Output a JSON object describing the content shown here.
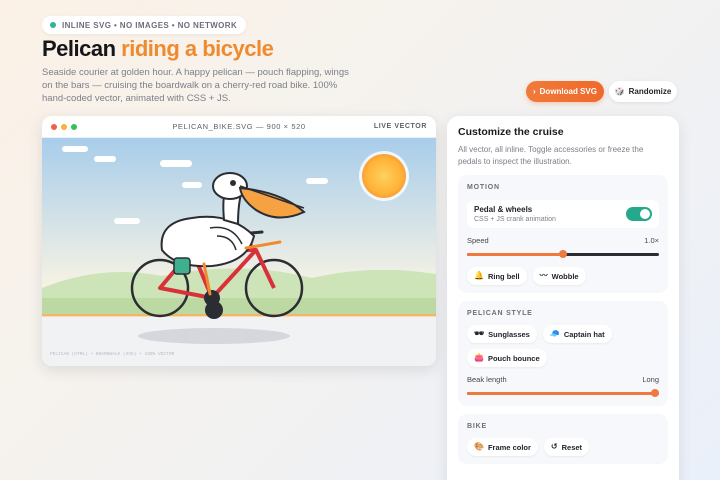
{
  "badge": "INLINE SVG • NO IMAGES • NO NETWORK",
  "title": {
    "main": "Pelican",
    "accent": "riding a bicycle"
  },
  "subtitle": "Seaside courier at golden hour. A happy pelican — pouch flapping, wings on the bars — cruising the boardwalk on a cherry-red road bike. 100% hand-coded vector, animated with CSS + JS.",
  "actions": {
    "download": "Download SVG",
    "randomize": "Randomize"
  },
  "stage": {
    "filename": "PELICAN_BIKE.SVG — 900 × 520",
    "mode": "LIVE VECTOR",
    "caption": "PELICAN (HTML) • BOARDWALK (SVG) • 100% VECTOR",
    "dot_colors": [
      "#f0604f",
      "#f4b23a",
      "#34c05a"
    ]
  },
  "panel": {
    "title": "Customize the cruise",
    "description": "All vector, all inline. Toggle accessories or freeze the pedals to inspect the illustration.",
    "motion": {
      "label": "MOTION",
      "toggle_title": "Pedal & wheels",
      "toggle_sub": "CSS + JS crank animation",
      "toggle_on": true,
      "speed_label": "Speed",
      "speed_value": "1.0×",
      "speed_fraction": 0.5,
      "ring_bell": "Ring bell",
      "wobble": "Wobble"
    },
    "style": {
      "label": "PELICAN STYLE",
      "sunglasses": "Sunglasses",
      "captain_hat": "Captain hat",
      "pouch_bounce": "Pouch bounce",
      "beak_label": "Beak length",
      "beak_value": "Long",
      "beak_fraction": 1.0
    },
    "bike": {
      "label": "BIKE",
      "frame_color": "Frame color",
      "reset": "Reset"
    }
  },
  "colors": {
    "accent": "#f08a2e",
    "toggle_on": "#25a98c",
    "bike_frame": "#d9313a"
  }
}
